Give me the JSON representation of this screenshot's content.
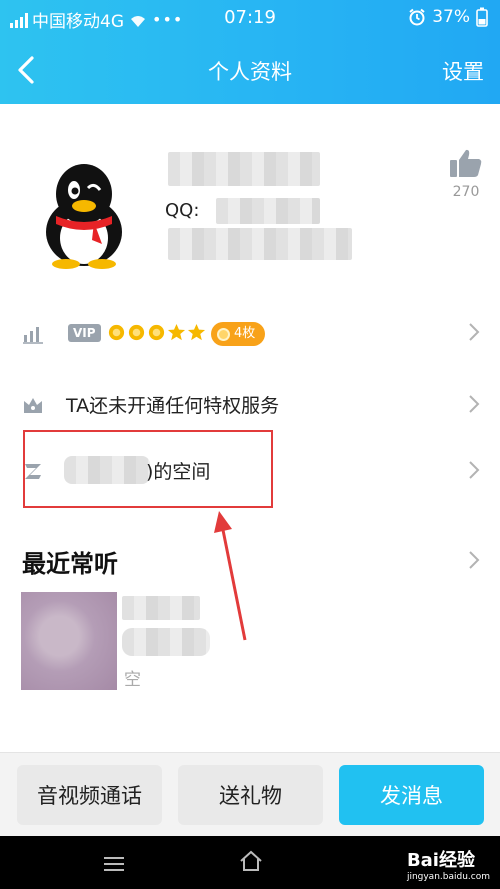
{
  "status_bar": {
    "carrier": "中国移动4G",
    "time": "07:19",
    "battery": "37%",
    "icons": [
      "signal-icon",
      "wifi-icon",
      "more-icon",
      "alarm-icon",
      "battery-icon"
    ]
  },
  "nav": {
    "title": "个人资料",
    "settings_label": "设置",
    "icons": [
      "back-arrow-icon"
    ]
  },
  "profile": {
    "qq_label": "QQ:",
    "like_count": "270",
    "icons": [
      "penguin-avatar-icon",
      "thumbs-up-icon"
    ]
  },
  "vip_row": {
    "vip_label": "VIP",
    "badge_count": "4枚",
    "crowns": 5,
    "icons": [
      "level-chart-icon",
      "crown-icon",
      "coin-icon",
      "chevron-right-icon"
    ]
  },
  "privilege_row": {
    "label": "TA还未开通任何特权服务",
    "icons": [
      "privilege-crown-icon",
      "chevron-right-icon"
    ]
  },
  "space_row": {
    "label": ")的空间",
    "icons": [
      "qzone-icon",
      "chevron-right-icon"
    ]
  },
  "recent": {
    "title": "最近常听",
    "empty_text": "空",
    "icons": [
      "chevron-right-icon"
    ]
  },
  "actions": {
    "video_call": "音视频通话",
    "send_gift": "送礼物",
    "send_message": "发消息"
  },
  "watermark": {
    "brand": "Bai经验",
    "url": "jingyan.baidu.com"
  },
  "colors": {
    "header": "#28b6f3",
    "primary_button": "#21c1f1",
    "annotation": "#e23b3b",
    "badge": "#f8a219"
  }
}
